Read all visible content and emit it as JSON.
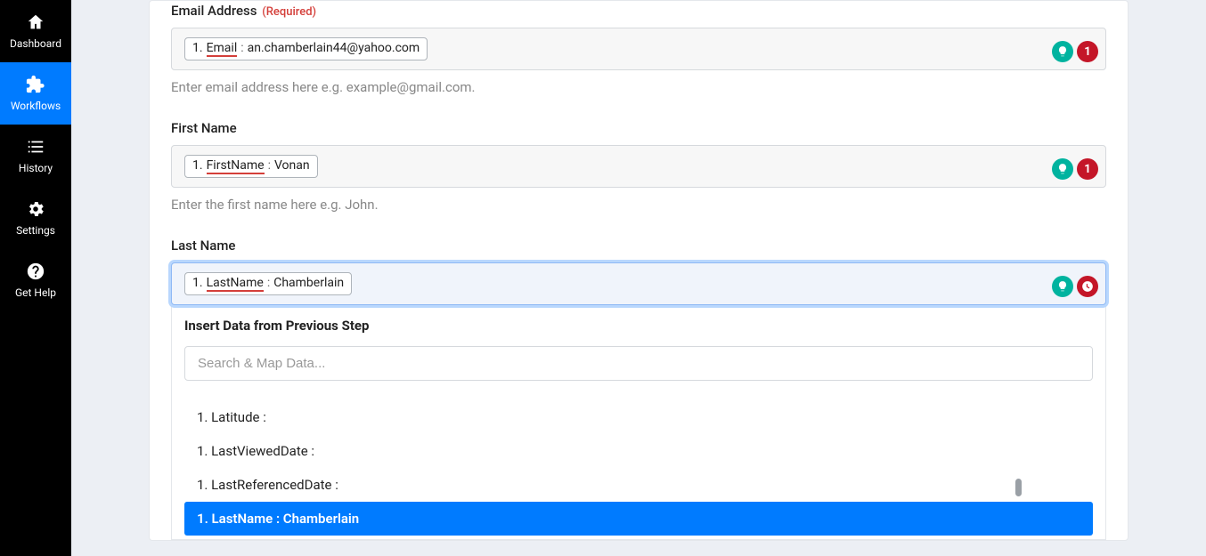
{
  "sidebar": {
    "items": [
      {
        "label": "Dashboard"
      },
      {
        "label": "Workflows"
      },
      {
        "label": "History"
      },
      {
        "label": "Settings"
      },
      {
        "label": "Get Help"
      }
    ]
  },
  "fields": {
    "email": {
      "label": "Email Address",
      "required": "(Required)",
      "token_prefix": "1.",
      "token_source": "Email",
      "token_sep": ":",
      "token_value": "an.chamberlain44@yahoo.com",
      "help": "Enter email address here e.g. example@gmail.com.",
      "step_badge": "1"
    },
    "first_name": {
      "label": "First Name",
      "token_prefix": "1.",
      "token_source": "FirstName",
      "token_sep": ":",
      "token_value": "Vonan",
      "help": "Enter the first name here e.g. John.",
      "step_badge": "1"
    },
    "last_name": {
      "label": "Last Name",
      "token_prefix": "1.",
      "token_source": "LastName",
      "token_sep": ":",
      "token_value": "Chamberlain"
    }
  },
  "dropdown": {
    "title": "Insert Data from Previous Step",
    "search_placeholder": "Search & Map Data...",
    "options": [
      "1. Latitude :",
      "1. LastViewedDate :",
      "1. LastReferencedDate :",
      "1. LastName : Chamberlain"
    ]
  }
}
